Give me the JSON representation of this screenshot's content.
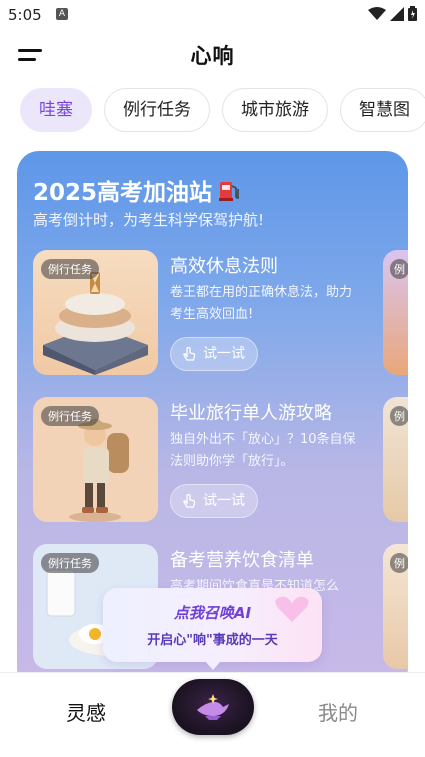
{
  "status": {
    "time": "5:05",
    "notif_letter": "A"
  },
  "app": {
    "title": "心响"
  },
  "tabs": [
    {
      "label": "哇塞",
      "active": true
    },
    {
      "label": "例行任务"
    },
    {
      "label": "城市旅游"
    },
    {
      "label": "智慧图"
    }
  ],
  "panel": {
    "title": "2025高考加油站",
    "subtitle": "高考倒计时，为考生科学保驾护航!",
    "cards": [
      {
        "badge": "例行任务",
        "title": "高效休息法则",
        "desc": "卷王都在用的正确休息法，助力考生高效回血!",
        "try_label": "试一试"
      },
      {
        "badge": "例行任务",
        "title": "毕业旅行单人游攻略",
        "desc": "独自外出不「放心」？10条自保法则助你学「放行」。",
        "try_label": "试一试"
      },
      {
        "badge": "例行任务",
        "title": "备考营养饮食清单",
        "desc": "高考期间饮食真是不知道怎么"
      }
    ],
    "side_badge": "例"
  },
  "ai_bubble": {
    "line1": "点我召唤AI",
    "line2": "开启心\"响\"事成的一天"
  },
  "bottom_nav": {
    "left": "灵感",
    "right": "我的"
  }
}
